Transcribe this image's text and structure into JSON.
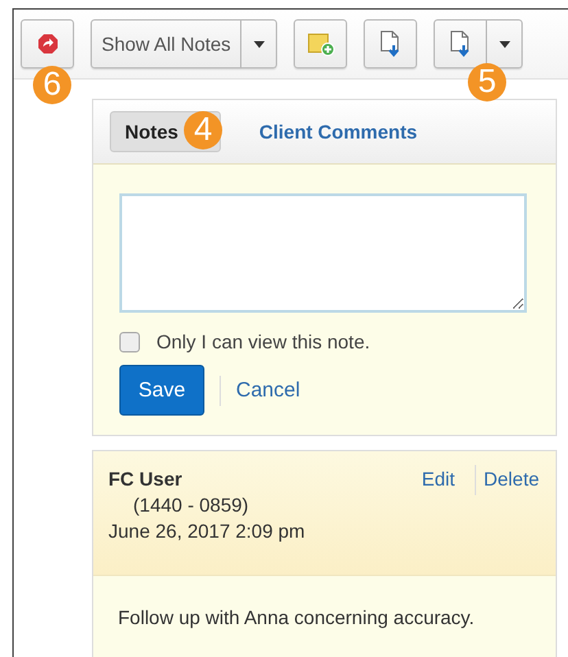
{
  "toolbar": [
    {
      "kind": "redirect"
    },
    {
      "kind": "filter",
      "label": "Show All Notes"
    },
    {
      "kind": "add-note"
    },
    {
      "kind": "export"
    },
    {
      "kind": "export-menu"
    }
  ],
  "callouts": [
    {
      "label": "6"
    },
    {
      "label": "5"
    },
    {
      "label": "4"
    }
  ],
  "tabs": [
    {
      "label": "Notes",
      "selected": true
    },
    {
      "label": "Client Comments",
      "selected": false
    }
  ],
  "form": {
    "private_label": "Only I can view this note.",
    "private_checked": false,
    "save": "Save",
    "cancel": "Cancel"
  },
  "notes": [
    {
      "author": "FC User",
      "code": "(1440 - 0859)",
      "date": "June 26, 2017 2:09 pm",
      "actions": [
        "Edit",
        "Delete"
      ],
      "body": "Follow up with Anna concerning accuracy."
    }
  ]
}
